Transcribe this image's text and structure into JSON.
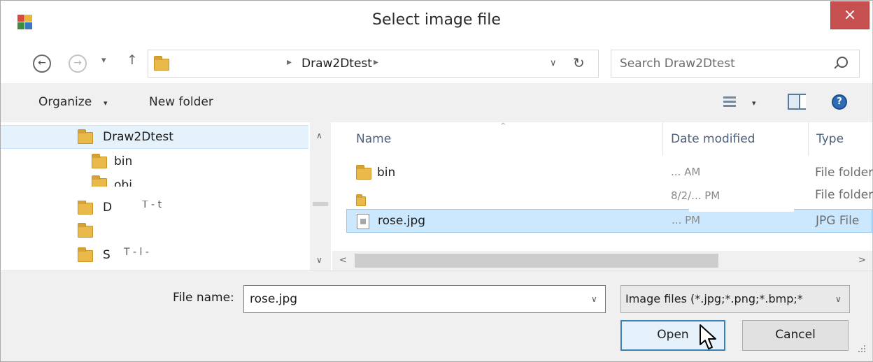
{
  "window": {
    "title": "Select image file",
    "close_label": "×"
  },
  "nav": {
    "back_glyph": "←",
    "forward_glyph": "→",
    "recent_glyph": "▾",
    "up_glyph": "↑",
    "breadcrumb": [
      "Draw2Dtest"
    ],
    "breadcrumb_sep": "▸",
    "dropdown_glyph": "∨",
    "refresh_glyph": "↻"
  },
  "search": {
    "placeholder": "Search Draw2Dtest"
  },
  "toolbar": {
    "organize_label": "Organize",
    "new_folder_label": "New folder",
    "caret": "▾"
  },
  "tree": {
    "items": [
      {
        "label": "Draw2Dtest",
        "selected": true
      },
      {
        "label": "bin"
      },
      {
        "label": "obj"
      },
      {
        "label": "D",
        "suffix": "T  - t"
      },
      {
        "label": ""
      },
      {
        "label": "S",
        "suffix": "T  - l -"
      }
    ],
    "scroll_up": "∧",
    "scroll_down": "∨"
  },
  "list": {
    "columns": {
      "name": "Name",
      "date": "Date modified",
      "type": "Type",
      "sort_glyph": "^"
    },
    "rows": [
      {
        "name": "bin",
        "date": "...   AM",
        "type": "File folder",
        "kind": "folder"
      },
      {
        "name": "",
        "date": "8/2/... PM",
        "type": "File folder",
        "kind": "folder"
      },
      {
        "name": "rose.jpg",
        "date": "... PM",
        "type": "JPG File",
        "kind": "file",
        "selected": true
      }
    ],
    "scroll_left": "<",
    "scroll_right": ">"
  },
  "bottom": {
    "file_name_label": "File name:",
    "file_name_value": "rose.jpg",
    "dropdown_glyph": "∨",
    "filter_value": "Image files (*.jpg;*.png;*.bmp;*",
    "open_label": "Open",
    "cancel_label": "Cancel"
  },
  "colors": {
    "close_button": "#c75050",
    "selection": "#cce8ff",
    "selection_border": "#99c9ef",
    "panel_bg": "#f0f0f0",
    "folder": "#e9b94a",
    "default_button_border": "#3c7fb1"
  },
  "icons": {
    "app": "app-window-icon",
    "back": "back-arrow-icon",
    "forward": "forward-arrow-icon",
    "up": "up-arrow-icon",
    "refresh": "refresh-icon",
    "search": "search-icon",
    "view": "view-options-icon",
    "preview_pane": "preview-pane-icon",
    "help": "help-icon",
    "folder": "folder-icon",
    "file": "jpg-file-icon",
    "cursor": "mouse-pointer-icon",
    "grip": "resize-grip-icon"
  }
}
